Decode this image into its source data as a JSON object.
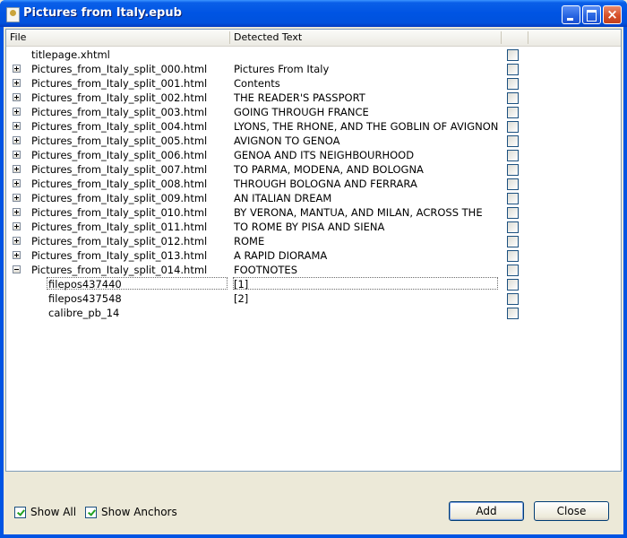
{
  "window": {
    "title": "Pictures from Italy.epub"
  },
  "table": {
    "columns": {
      "file": "File",
      "text": "Detected Text"
    },
    "rows": [
      {
        "file": "titlepage.xhtml",
        "text": "",
        "toggle": "none",
        "level": 0
      },
      {
        "file": "Pictures_from_Italy_split_000.html",
        "text": "Pictures From Italy",
        "toggle": "plus",
        "level": 0
      },
      {
        "file": "Pictures_from_Italy_split_001.html",
        "text": "Contents",
        "toggle": "plus",
        "level": 0
      },
      {
        "file": "Pictures_from_Italy_split_002.html",
        "text": "THE READER'S PASSPORT",
        "toggle": "plus",
        "level": 0
      },
      {
        "file": "Pictures_from_Italy_split_003.html",
        "text": "GOING THROUGH FRANCE",
        "toggle": "plus",
        "level": 0
      },
      {
        "file": "Pictures_from_Italy_split_004.html",
        "text": "LYONS, THE RHONE, AND THE GOBLIN OF AVIGNON",
        "toggle": "plus",
        "level": 0
      },
      {
        "file": "Pictures_from_Italy_split_005.html",
        "text": "AVIGNON TO GENOA",
        "toggle": "plus",
        "level": 0
      },
      {
        "file": "Pictures_from_Italy_split_006.html",
        "text": "GENOA AND ITS NEIGHBOURHOOD",
        "toggle": "plus",
        "level": 0
      },
      {
        "file": "Pictures_from_Italy_split_007.html",
        "text": "TO PARMA, MODENA, AND BOLOGNA",
        "toggle": "plus",
        "level": 0
      },
      {
        "file": "Pictures_from_Italy_split_008.html",
        "text": "THROUGH BOLOGNA AND FERRARA",
        "toggle": "plus",
        "level": 0
      },
      {
        "file": "Pictures_from_Italy_split_009.html",
        "text": "AN ITALIAN DREAM",
        "toggle": "plus",
        "level": 0
      },
      {
        "file": "Pictures_from_Italy_split_010.html",
        "text": "BY VERONA, MANTUA, AND MILAN, ACROSS THE",
        "toggle": "plus",
        "level": 0
      },
      {
        "file": "Pictures_from_Italy_split_011.html",
        "text": "TO ROME BY PISA AND SIENA",
        "toggle": "plus",
        "level": 0
      },
      {
        "file": "Pictures_from_Italy_split_012.html",
        "text": "ROME",
        "toggle": "plus",
        "level": 0
      },
      {
        "file": "Pictures_from_Italy_split_013.html",
        "text": "A RAPID DIORAMA",
        "toggle": "plus",
        "level": 0
      },
      {
        "file": "Pictures_from_Italy_split_014.html",
        "text": "FOOTNOTES",
        "toggle": "minus",
        "level": 0
      },
      {
        "file": "filepos437440",
        "text": "[1]",
        "toggle": "none",
        "level": 1,
        "selected": true
      },
      {
        "file": "filepos437548",
        "text": "[2]",
        "toggle": "none",
        "level": 1
      },
      {
        "file": "calibre_pb_14",
        "text": "",
        "toggle": "none",
        "level": 1
      }
    ]
  },
  "footer": {
    "show_all": {
      "label": "Show All",
      "checked": true
    },
    "show_anchors": {
      "label": "Show Anchors",
      "checked": true
    },
    "add_label": "Add",
    "close_label": "Close"
  }
}
